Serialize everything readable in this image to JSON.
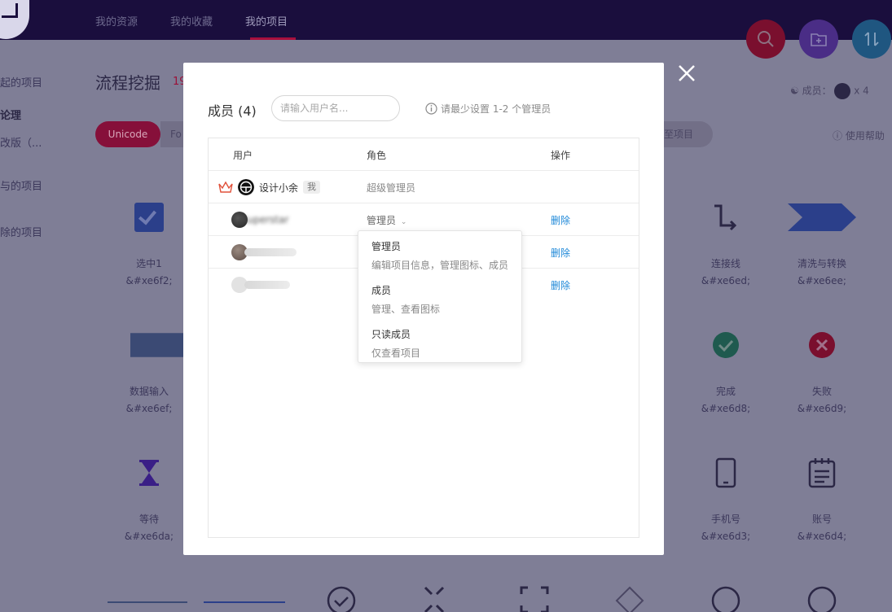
{
  "nav": {
    "items": [
      "我的资源",
      "我的收藏",
      "我的项目"
    ],
    "active": 2
  },
  "sidebar": {
    "items": [
      "起的项目",
      "论理",
      "改版（...",
      "与的项目",
      "除的项目"
    ]
  },
  "project": {
    "title": "流程挖掘",
    "count": "19",
    "tab_unicode": "Unicode",
    "tab_font": "Fo",
    "go_project": "至项目",
    "members_label": "成员：",
    "members_count": "x 4",
    "help": "使用帮助"
  },
  "icons": [
    {
      "name": "选中1",
      "code": "&#xe6f2;"
    },
    {
      "name": "连接线",
      "code": "&#xe6ed;"
    },
    {
      "name": "清洗与转换",
      "code": "&#xe6ee;"
    },
    {
      "name": "数据输入",
      "code": "&#xe6ef;"
    },
    {
      "name": "完成",
      "code": "&#xe6d8;"
    },
    {
      "name": "失败",
      "code": "&#xe6d9;"
    },
    {
      "name": "等待",
      "code": "&#xe6da;"
    },
    {
      "name": "手机号",
      "code": "&#xe6d3;"
    },
    {
      "name": "账号",
      "code": "&#xe6d4;"
    }
  ],
  "modal": {
    "title": "成员 (4)",
    "search_placeholder": "请输入用户名...",
    "tip": "请最少设置 1-2 个管理员",
    "columns": {
      "user": "用户",
      "role": "角色",
      "action": "操作"
    },
    "rows": [
      {
        "user": "设计小余",
        "badge": "我",
        "role": "超级管理员",
        "action": ""
      },
      {
        "user": "Superstar",
        "role": "管理员",
        "action": "删除"
      },
      {
        "user": "",
        "role": "",
        "action": "删除"
      },
      {
        "user": "",
        "role": "",
        "action": "删除"
      }
    ],
    "dropdown": [
      {
        "title": "管理员",
        "desc": "编辑项目信息，管理图标、成员"
      },
      {
        "title": "成员",
        "desc": "管理、查看图标"
      },
      {
        "title": "只读成员",
        "desc": "仅查看项目"
      }
    ]
  },
  "colors": {
    "topbar": "#1a0e3d",
    "overlay": "#7f7e96",
    "accent": "#a8103d",
    "link": "#1e88d8"
  }
}
